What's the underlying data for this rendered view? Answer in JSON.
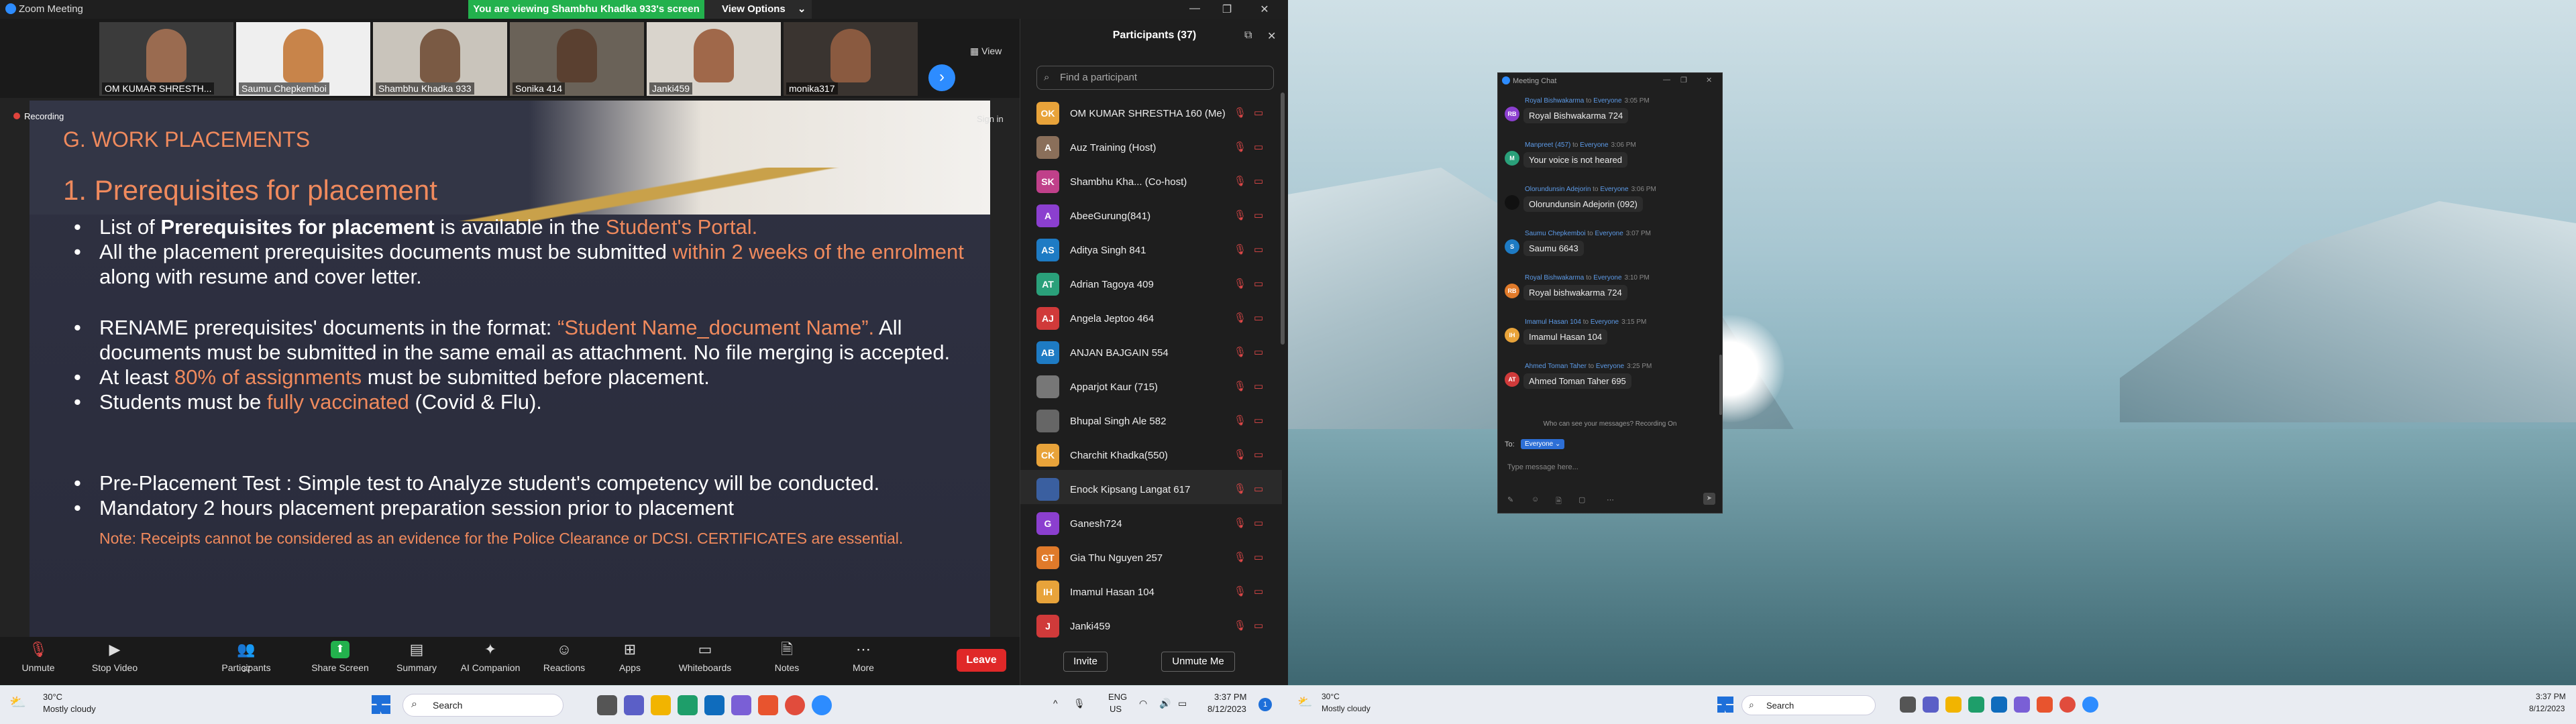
{
  "zoom": {
    "window_title": "Zoom Meeting",
    "viewing_banner": "You are viewing Shambhu Khadka 933's screen",
    "view_options_label": "View Options",
    "view_label": "View",
    "recording_label": "Recording",
    "sign_in_label": "Sign in",
    "thumbnails": [
      {
        "label": "OM KUMAR SHRESTH..."
      },
      {
        "label": "Saumu Chepkemboi"
      },
      {
        "label": "Shambhu Khadka 933"
      },
      {
        "label": "Sonika 414"
      },
      {
        "label": "Janki459"
      },
      {
        "label": "monika317"
      }
    ],
    "slide": {
      "heading": "G. WORK PLACEMENTS",
      "subheading": "1. Prerequisites for placement",
      "b1_pre": "List of ",
      "b1_bold": "Prerequisites for placement",
      "b1_mid": " is available in the ",
      "b1_hl": "Student's Portal.",
      "b2_pre": "All the placement prerequisites documents must be submitted ",
      "b2_hl": "within 2 weeks of the enrolment",
      "b2_post": " along with resume and cover letter.",
      "b3_pre": "RENAME prerequisites' documents in the format: ",
      "b3_hl": "“Student Name_document Name”.",
      "b3_post": " All documents must be submitted in the same email as attachment. No file merging is accepted.",
      "b4_pre": "At least ",
      "b4_hl": "80% of assignments",
      "b4_post": " must be submitted before placement.",
      "b5_pre": "Students must be ",
      "b5_hl": "fully vaccinated",
      "b5_post": " (Covid & Flu).",
      "b6": "Pre-Placement Test : Simple test to Analyze student's competency will be conducted.",
      "b7": "Mandatory 2 hours placement preparation session prior to placement",
      "note": "Note: Receipts cannot be considered as an evidence for the Police Clearance or DCSI. CERTIFICATES are essential."
    },
    "toolbar": {
      "unmute": "Unmute",
      "stop_video": "Stop Video",
      "participants": "Participants",
      "participants_count": "37",
      "share_screen": "Share Screen",
      "summary": "Summary",
      "ai_companion": "AI Companion",
      "reactions": "Reactions",
      "apps": "Apps",
      "whiteboards": "Whiteboards",
      "notes": "Notes",
      "more": "More",
      "leave": "Leave"
    },
    "participants_panel": {
      "title": "Participants (37)",
      "search_placeholder": "Find a participant",
      "invite": "Invite",
      "unmute_me": "Unmute Me",
      "rows": [
        {
          "initials": "OK",
          "name": "OM KUMAR SHRESTHA 160 (Me)",
          "color": "#e8a33a"
        },
        {
          "initials": "A",
          "name": "Auz Training (Host)",
          "color": "#8a6f5a"
        },
        {
          "initials": "SK",
          "name": "Shambhu Kha... (Co-host)",
          "color": "#c0408a"
        },
        {
          "initials": "A",
          "name": "AbeeGurung(841)",
          "color": "#8b3fcf"
        },
        {
          "initials": "AS",
          "name": "Aditya Singh 841",
          "color": "#1e7bc4"
        },
        {
          "initials": "AT",
          "name": "Adrian Tagoya 409",
          "color": "#2aa07a"
        },
        {
          "initials": "AJ",
          "name": "Angela Jeptoo 464",
          "color": "#d03a3a"
        },
        {
          "initials": "AB",
          "name": "ANJAN BAJGAIN 554",
          "color": "#1e7bc4"
        },
        {
          "initials": "",
          "name": "Apparjot Kaur (715)",
          "color": "#777777"
        },
        {
          "initials": "",
          "name": "Bhupal Singh Ale 582",
          "color": "#666666"
        },
        {
          "initials": "CK",
          "name": "Charchit Khadka(550)",
          "color": "#e8a33a"
        },
        {
          "initials": "",
          "name": "Enock Kipsang Langat 617",
          "color": "#3a5fa0"
        },
        {
          "initials": "G",
          "name": "Ganesh724",
          "color": "#8b3fcf"
        },
        {
          "initials": "GT",
          "name": "Gia Thu Nguyen 257",
          "color": "#e07a2a"
        },
        {
          "initials": "IH",
          "name": "Imamul Hasan 104",
          "color": "#e8a33a"
        },
        {
          "initials": "J",
          "name": "Janki459",
          "color": "#d03a3a"
        }
      ]
    }
  },
  "taskbar_left": {
    "weather_temp": "30°C",
    "weather_desc": "Mostly cloudy",
    "search": "Search",
    "lang1": "ENG",
    "lang2": "US",
    "time": "3:37 PM",
    "date": "8/12/2023",
    "notif": "1"
  },
  "chat": {
    "title": "Meeting Chat",
    "messages": [
      {
        "initials": "RB",
        "from": "Royal Bishwakarma",
        "to": "Everyone",
        "time": "3:05 PM",
        "text": "Royal Bishwakarma 724",
        "color": "#8b3fcf"
      },
      {
        "initials": "M",
        "from": "Manpreet (457)",
        "to": "Everyone",
        "time": "3:06 PM",
        "text": "Your voice is not heared",
        "color": "#2aa07a"
      },
      {
        "initials": "",
        "from": "Olorundunsin Adejorin",
        "to": "Everyone",
        "time": "3:06 PM",
        "text": "Olorundunsin Adejorin (092)",
        "color": "#111111"
      },
      {
        "initials": "S",
        "from": "Saumu Chepkemboi",
        "to": "Everyone",
        "time": "3:07 PM",
        "text": "Saumu 6643",
        "color": "#1e7bc4"
      },
      {
        "initials": "RB",
        "from": "Royal Bishwakarma",
        "to": "Everyone",
        "time": "3:10 PM",
        "text": "Royal bishwakarma 724",
        "color": "#e07a2a"
      },
      {
        "initials": "IH",
        "from": "Imamul Hasan 104",
        "to": "Everyone",
        "time": "3:15 PM",
        "text": "Imamul Hasan 104",
        "color": "#e8a33a"
      },
      {
        "initials": "AT",
        "from": "Ahmed Toman Taher",
        "to": "Everyone",
        "time": "3:25 PM",
        "text": "Ahmed Toman Taher 695",
        "color": "#d03a3a"
      }
    ],
    "notice": "Who can see your messages? Recording On",
    "to_label": "To:",
    "to_value": "Everyone",
    "input_placeholder": "Type message here..."
  },
  "taskbar_right": {
    "weather_temp": "30°C",
    "weather_desc": "Mostly cloudy",
    "search": "Search",
    "time": "3:37 PM",
    "date": "8/12/2023"
  }
}
